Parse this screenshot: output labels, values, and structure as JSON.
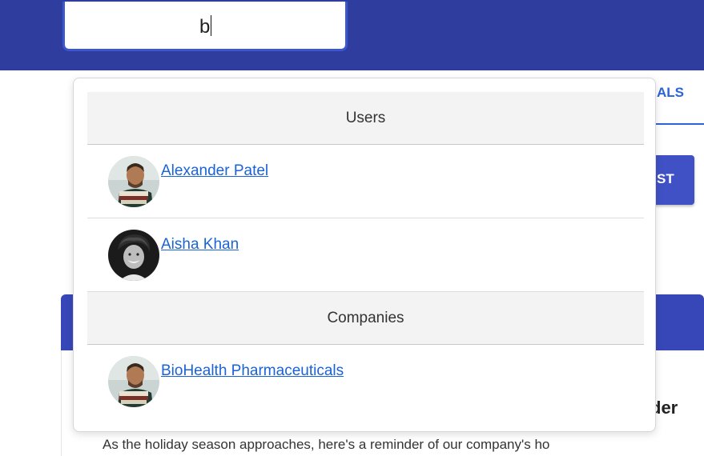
{
  "search": {
    "query": "b"
  },
  "background": {
    "tab_fragment": "ALS",
    "button_fragment": "ST",
    "card_heading_fragment": "der",
    "card_text": "As the holiday season approaches, here's a reminder of our company's ho"
  },
  "dropdown": {
    "users_header": "Users",
    "users": [
      {
        "name": "Alexander Patel",
        "avatar": "man-with-books-avatar"
      },
      {
        "name": "Aisha Khan",
        "avatar": "smiling-person-bw-avatar"
      }
    ],
    "companies_header": "Companies",
    "companies": [
      {
        "name": "BioHealth Pharmaceuticals",
        "avatar": "man-with-books-avatar"
      }
    ]
  },
  "colors": {
    "topbar": "#2f3e9e",
    "link": "#1a63d6",
    "accent_button": "#3f51c4"
  }
}
